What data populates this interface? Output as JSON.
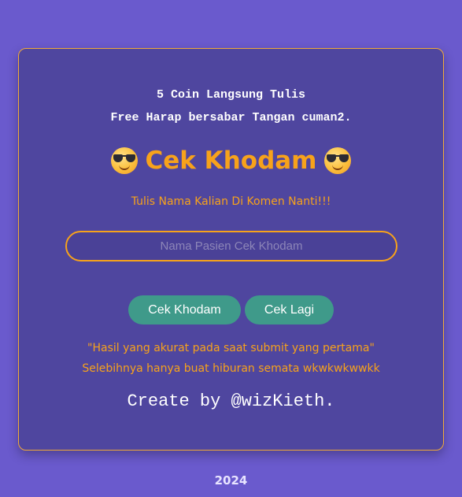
{
  "notice": {
    "line1": "5 Coin Langsung Tulis",
    "line2": "Free Harap bersabar Tangan cuman2."
  },
  "title": {
    "text": "Cek Khodam",
    "left_icon": "smiling-face-with-sunglasses-icon",
    "right_icon": "smiling-face-with-sunglasses-icon"
  },
  "instruction": "Tulis Nama Kalian Di Komen Nanti!!!",
  "name_input": {
    "value": "",
    "placeholder": "Nama Pasien Cek Khodam"
  },
  "buttons": {
    "check_label": "Cek Khodam",
    "again_label": "Cek Lagi"
  },
  "result": {
    "line1": "\"Hasil yang akurat pada saat submit yang pertama\"",
    "line2": "Selebihnya hanya buat hiburan semata wkwkwkwwkk"
  },
  "credit": "Create by @wizKieth.",
  "footer": {
    "year": "2024"
  },
  "colors": {
    "background": "#6a5acd",
    "card": "#4f469f",
    "accent": "#f7a21b",
    "button": "#3f9a8a"
  }
}
